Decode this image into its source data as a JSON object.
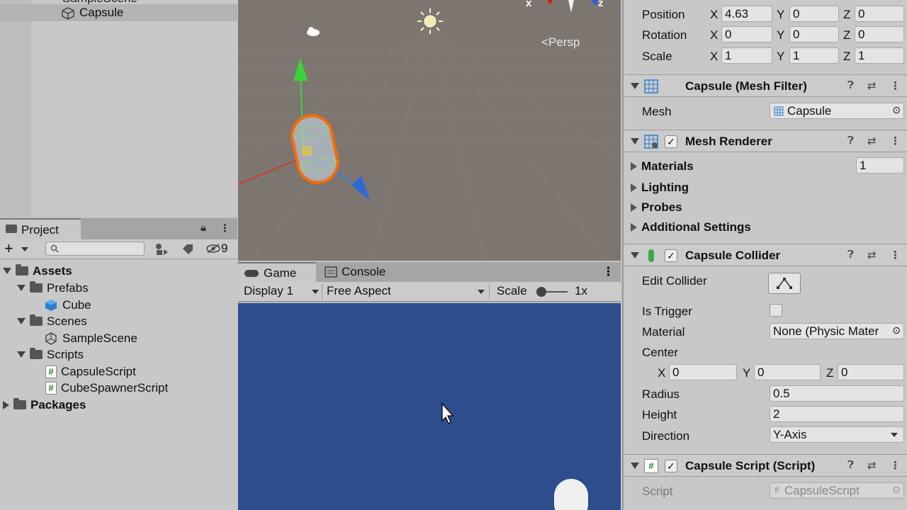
{
  "hierarchy": {
    "partial_item": "SampleScene",
    "selected_item": "Capsule"
  },
  "project": {
    "tab_label": "Project",
    "hidden_count": "9",
    "tree": {
      "assets": "Assets",
      "prefabs": "Prefabs",
      "cube": "Cube",
      "scenes": "Scenes",
      "sample_scene": "SampleScene",
      "scripts": "Scripts",
      "capsule_script": "CapsuleScript",
      "cube_spawner_script": "CubeSpawnerScript",
      "packages": "Packages"
    }
  },
  "scene": {
    "persp_label": "Persp",
    "gizmo_x": "x",
    "gizmo_z": "z"
  },
  "game": {
    "tab_game": "Game",
    "tab_console": "Console",
    "display": "Display 1",
    "aspect": "Free Aspect",
    "scale_label": "Scale",
    "scale_value": "1x"
  },
  "inspector": {
    "transform": {
      "position_label": "Position",
      "rotation_label": "Rotation",
      "scale_label": "Scale",
      "x": "X",
      "y": "Y",
      "z": "Z",
      "pos_x": "4.63",
      "pos_y": "0",
      "pos_z": "0",
      "rot_x": "0",
      "rot_y": "0",
      "rot_z": "0",
      "scl_x": "1",
      "scl_y": "1",
      "scl_z": "1"
    },
    "mesh_filter": {
      "title": "Capsule (Mesh Filter)",
      "mesh_label": "Mesh",
      "mesh_value": "Capsule"
    },
    "mesh_renderer": {
      "title": "Mesh Renderer",
      "materials": "Materials",
      "materials_count": "1",
      "lighting": "Lighting",
      "probes": "Probes",
      "additional": "Additional Settings"
    },
    "capsule_collider": {
      "title": "Capsule Collider",
      "edit_collider": "Edit Collider",
      "is_trigger": "Is Trigger",
      "material_label": "Material",
      "material_value": "None (Physic Mater",
      "center_label": "Center",
      "cx": "0",
      "cy": "0",
      "cz": "0",
      "radius_label": "Radius",
      "radius_value": "0.5",
      "height_label": "Height",
      "height_value": "2",
      "direction_label": "Direction",
      "direction_value": "Y-Axis"
    },
    "capsule_script": {
      "title": "Capsule Script (Script)",
      "script_label": "Script",
      "script_value": "CapsuleScript"
    }
  },
  "colors": {
    "game_background": "#2e4d8d",
    "scene_background": "#7d7670",
    "selection_outline": "#ff6a00"
  }
}
